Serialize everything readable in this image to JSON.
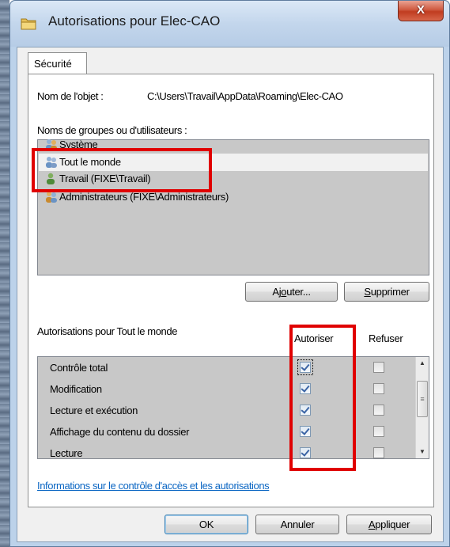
{
  "window": {
    "title": "Autorisations pour Elec-CAO",
    "close_label": "X"
  },
  "tabs": [
    {
      "label": "Sécurité",
      "active": true
    }
  ],
  "object": {
    "label": "Nom de l'objet :",
    "path": "C:\\Users\\Travail\\AppData\\Roaming\\Elec-CAO"
  },
  "groups": {
    "label": "Noms de groupes ou d'utilisateurs :",
    "items": [
      {
        "name": "Système",
        "selected": false
      },
      {
        "name": "Tout le monde",
        "selected": true
      },
      {
        "name": "Travail (FIXE\\Travail)",
        "selected": false
      },
      {
        "name": "Administrateurs (FIXE\\Administrateurs)",
        "selected": false
      }
    ],
    "add_button": {
      "prefix": "Aj",
      "underline": "o",
      "suffix": "uter..."
    },
    "remove_button": {
      "prefix": "",
      "underline": "S",
      "suffix": "upprimer"
    }
  },
  "permissions": {
    "title": "Autorisations pour Tout le monde",
    "col_allow": "Autoriser",
    "col_deny": "Refuser",
    "rows": [
      {
        "name": "Contrôle total",
        "allow": true,
        "deny": false
      },
      {
        "name": "Modification",
        "allow": true,
        "deny": false
      },
      {
        "name": "Lecture et exécution",
        "allow": true,
        "deny": false
      },
      {
        "name": "Affichage du contenu du dossier",
        "allow": true,
        "deny": false
      },
      {
        "name": "Lecture",
        "allow": true,
        "deny": false
      }
    ]
  },
  "info_link": "Informations sur le contrôle d'accès et les autorisations",
  "footer": {
    "ok": "OK",
    "cancel": "Annuler",
    "apply": {
      "prefix": "",
      "underline": "A",
      "suffix": "ppliquer"
    }
  },
  "colors": {
    "highlight_box": "#e00000",
    "link": "#0b66c3"
  }
}
